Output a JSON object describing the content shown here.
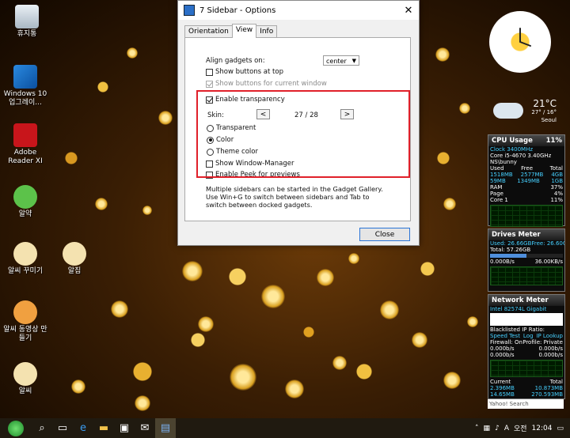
{
  "window": {
    "title": "7 Sidebar - Options",
    "close_glyph": "✕",
    "tabs": [
      {
        "label": "Orientation"
      },
      {
        "label": "View"
      },
      {
        "label": "Info"
      }
    ],
    "active_tab": "View"
  },
  "view": {
    "align_label": "Align gadgets on:",
    "align_value": "center",
    "show_buttons_top": {
      "label": "Show buttons at top",
      "checked": false
    },
    "show_buttons_current": {
      "label": "Show buttons for current window",
      "checked": true,
      "disabled": true
    },
    "enable_transparency": {
      "label": "Enable transparency",
      "checked": true
    },
    "skin_label": "Skin:",
    "skin_prev": "<",
    "skin_value": "27 / 28",
    "skin_next": ">",
    "radio_transparent": {
      "label": "Transparent",
      "selected": false
    },
    "radio_color": {
      "label": "Color",
      "selected": true
    },
    "radio_theme": {
      "label": "Theme color",
      "selected": false
    },
    "show_window_manager": {
      "label": "Show Window-Manager",
      "checked": false
    },
    "enable_peek": {
      "label": "Enable Peek for previews",
      "checked": false
    },
    "info_text": "Multiple sidebars can be started in the Gadget Gallery. Use Win+G to switch between sidebars and Tab to switch between docked gadgets.",
    "close_label": "Close"
  },
  "desktop_icons": [
    {
      "name": "recycle-bin-icon",
      "label": "휴지통"
    },
    {
      "name": "windows10-icon",
      "label": "Windows 10 업그레이..."
    },
    {
      "name": "adobe-reader-icon",
      "label": "Adobe Reader XI"
    },
    {
      "name": "alyak-icon",
      "label": "알약"
    },
    {
      "name": "alssi-kkumigi-icon",
      "label": "알씨 꾸미기"
    },
    {
      "name": "aljip-icon",
      "label": "알집"
    },
    {
      "name": "alssi-video-icon",
      "label": "알씨 동영상 만들기"
    },
    {
      "name": "alssi-icon",
      "label": "알씨"
    }
  ],
  "weather": {
    "temp": "21°C",
    "range": "27° / 16°",
    "city": "Seoul"
  },
  "cpu_gadget": {
    "title": "CPU Usage",
    "percent": "11%",
    "clock": "Clock 3400MHz",
    "cpu": "Core i5-4670 3.40GHz",
    "user": "NS\\bunny",
    "head": [
      "Used",
      "Free",
      "Total"
    ],
    "mem1": [
      "1518MB",
      "2577MB",
      "4GB"
    ],
    "mem2": [
      "59MB",
      "1349MB",
      "1GB"
    ],
    "ram": "RAM",
    "ram_pct": "37%",
    "page": "Page",
    "page_pct": "4%",
    "core": "Core 1",
    "core_pct": "11%",
    "cpu_level": 0.11,
    "ram_level": 0.37
  },
  "drives_gadget": {
    "title": "Drives Meter",
    "used": "Used: 26.66GB",
    "free": "Free: 26.60GB",
    "total": "Total: 57.26GB",
    "read": "0.000B/s",
    "write": "36.00KB/s"
  },
  "network_gadget": {
    "title": "Network Meter",
    "adapter": "Intel 82574L Gigabit",
    "blacklist": "Blacklisted IP Ratio:",
    "links": [
      "Speed Test",
      "Log",
      "IP Lookup"
    ],
    "firewall": "Firewall: On",
    "profile": "Profile: Private",
    "up1": "0.000b/s",
    "down1": "0.000b/s",
    "up2": "0.000b/s",
    "down2": "0.000b/s",
    "current_label": "Current",
    "total_label": "Total",
    "cur_up": "2.396MB",
    "cur_down": "14.65MB",
    "tot_up": "10.873MB",
    "tot_down": "270.593MB"
  },
  "yahoo_search": "Yahoo! Search",
  "taskbar": {
    "language": "A",
    "ampm": "오전",
    "time": "12:04"
  }
}
